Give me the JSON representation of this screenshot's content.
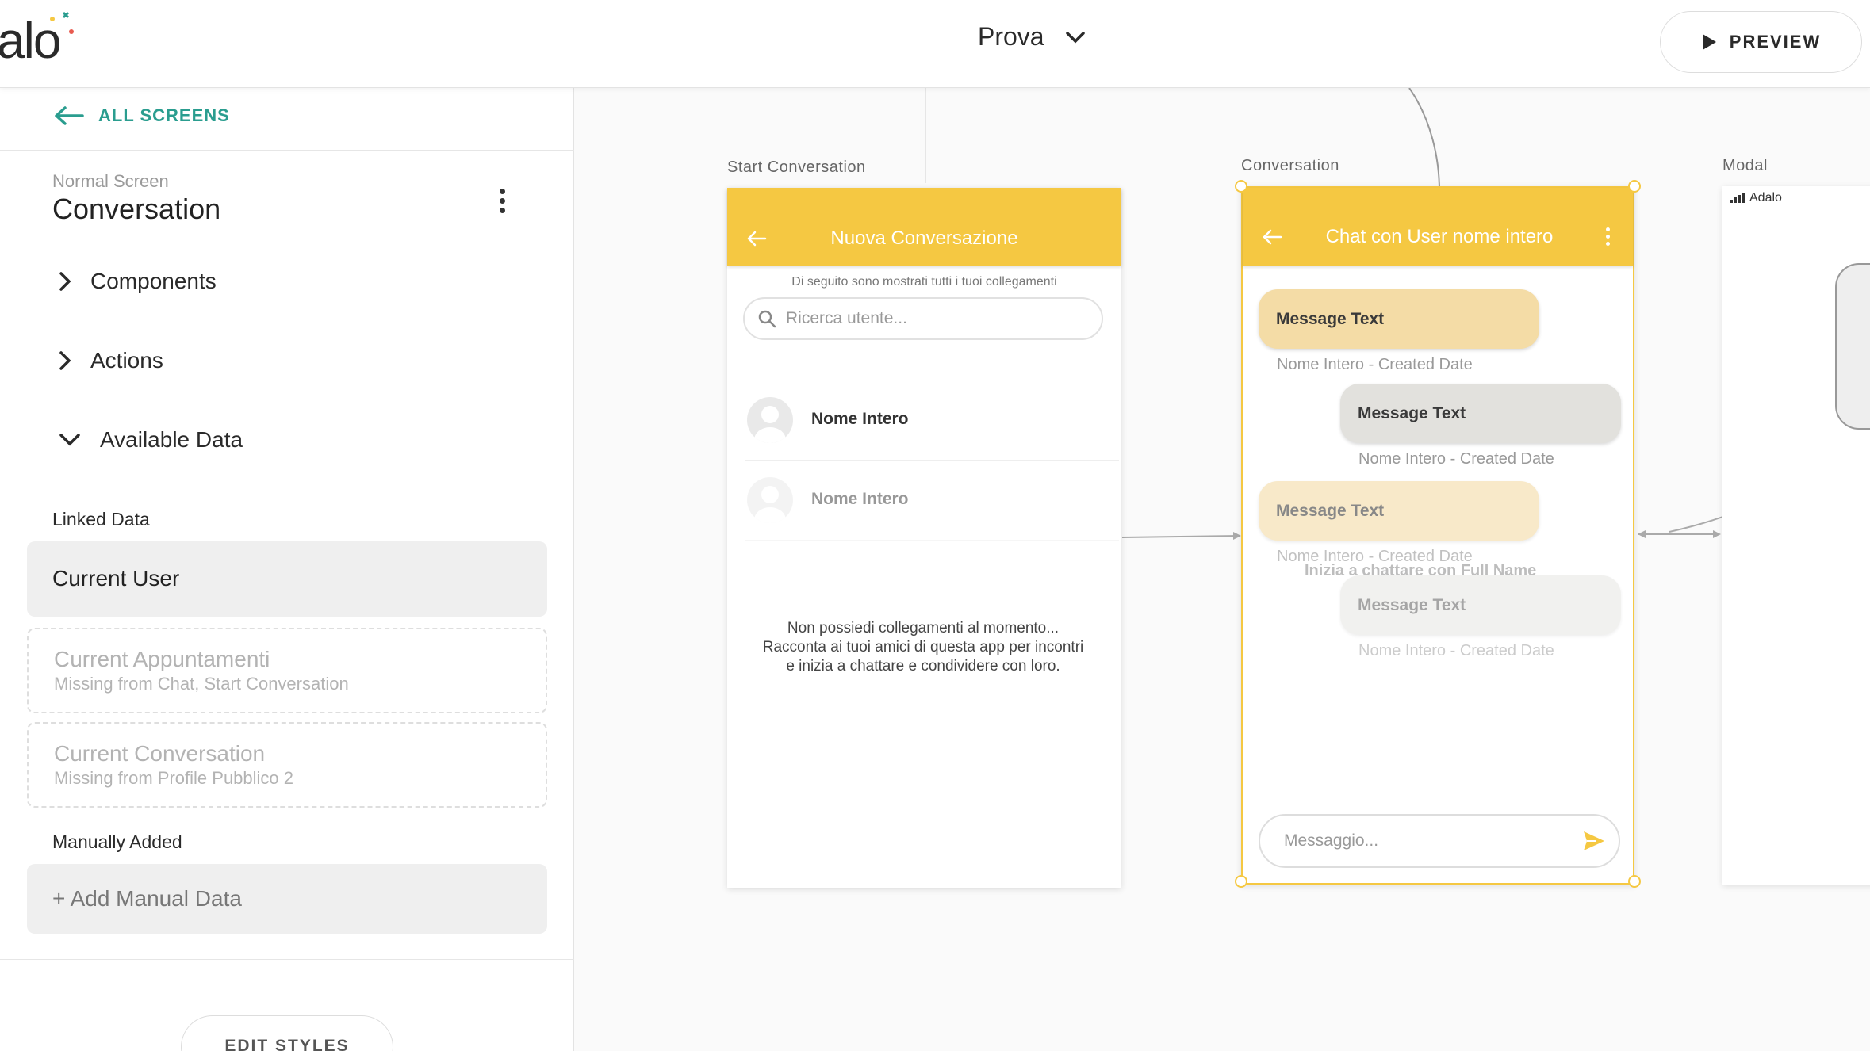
{
  "header": {
    "logo_text": "alo",
    "project_name": "Prova",
    "preview_label": "PREVIEW"
  },
  "sidebar": {
    "back_label": "ALL SCREENS",
    "screen_kind": "Normal Screen",
    "screen_name": "Conversation",
    "components_label": "Components",
    "actions_label": "Actions",
    "available_data_label": "Available Data",
    "linked_data_label": "Linked Data",
    "linked": [
      {
        "title": "Current User",
        "sub": ""
      },
      {
        "title": "Current Appuntamenti",
        "sub": "Missing from Chat, Start Conversation"
      },
      {
        "title": "Current Conversation",
        "sub": "Missing from Profile Pubblico 2"
      }
    ],
    "manually_added_label": "Manually Added",
    "add_manual_label": "+ Add Manual Data",
    "edit_styles_label": "EDIT STYLES"
  },
  "canvas": {
    "start_conversation": {
      "label": "Start Conversation",
      "title": "Nuova Conversazione",
      "subtitle": "Di seguito sono mostrati tutti i tuoi collegamenti",
      "search_placeholder": "Ricerca utente...",
      "users": [
        "Nome Intero",
        "Nome Intero"
      ],
      "empty_message": "Non possiedi collegamenti al momento... Racconta ai tuoi amici di questa app per incontri e inizia a chattare e condividere con loro."
    },
    "conversation": {
      "label": "Conversation",
      "title": "Chat con User nome intero",
      "messages": [
        {
          "text": "Message Text",
          "meta": "Nome Intero - Created Date"
        },
        {
          "text": "Message Text",
          "meta": "Nome Intero - Created Date"
        },
        {
          "text": "Message Text",
          "meta": "Nome Intero - Created Date"
        },
        {
          "text": "Message Text",
          "meta": "Nome Intero - Created Date"
        }
      ],
      "start_chat_text": "Inizia a chattare con Full Name",
      "input_placeholder": "Messaggio..."
    },
    "modal": {
      "label": "Modal",
      "status_text": "Adalo"
    }
  },
  "colors": {
    "accent": "#2a9d8f",
    "appbar": "#f5c842",
    "bubble_mine": "#f4dca6",
    "bubble_theirs": "#e2e1dd"
  },
  "icons": {
    "back": "arrow-left-icon",
    "play": "play-icon",
    "chevron": "chevron-down-icon",
    "search": "search-icon",
    "send": "send-icon",
    "more": "more-vertical-icon",
    "avatar": "user-avatar-icon"
  }
}
